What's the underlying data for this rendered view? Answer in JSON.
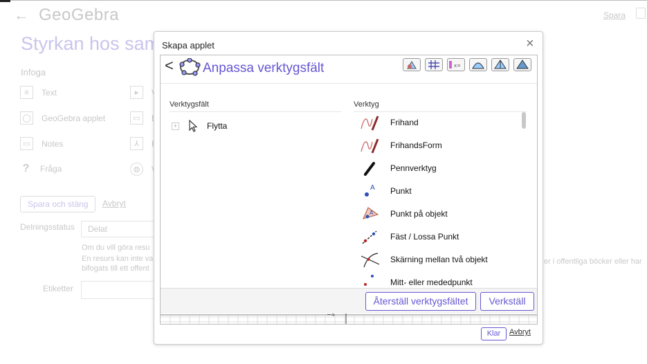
{
  "header": {
    "back_glyph": "←",
    "logo": "GeoGebra",
    "save_link": "Spara",
    "print_icon": "print-icon"
  },
  "background": {
    "title": "Styrkan hos samb",
    "insert_heading": "Infoga",
    "insert_left": [
      {
        "label": "Text",
        "icon": "text-icon"
      },
      {
        "label": "GeoGebra applet",
        "icon": "geogebra-icon"
      },
      {
        "label": "Notes",
        "icon": "notes-icon"
      },
      {
        "label": "Fråga",
        "icon": "question-icon"
      }
    ],
    "insert_right": [
      {
        "label": "V",
        "icon": "video-icon"
      },
      {
        "label": "E",
        "icon": "image-icon"
      },
      {
        "label": "F",
        "icon": "pdf-icon"
      },
      {
        "label": "V",
        "icon": "web-icon"
      }
    ],
    "save_close": "Spara och stäng",
    "cancel": "Avbryt",
    "sharing_label": "Delningsstatus",
    "sharing_value": "Delat",
    "notice_lines": [
      "Om du vill göra resu",
      "En resurs kan inte va",
      "bifogats till ett offent"
    ],
    "notice_right": "er i offentliga böcker eller har",
    "tags_label": "Etiketter"
  },
  "dialog": {
    "title": "Skapa applet",
    "close_glyph": "×",
    "toolbar_editor": {
      "back_glyph": "<",
      "title": "Anpassa verktygsfält",
      "toolbar_column": "Verktygsfält",
      "tools_column": "Verktyg",
      "toolbar_items": [
        {
          "label": "Flytta"
        }
      ],
      "tools": [
        {
          "label": "Frihand",
          "icon": "freehand-icon"
        },
        {
          "label": "FrihandsForm",
          "icon": "freehand-shape-icon"
        },
        {
          "label": "Pennverktyg",
          "icon": "pen-icon"
        },
        {
          "label": "Punkt",
          "icon": "point-icon"
        },
        {
          "label": "Punkt på objekt",
          "icon": "point-on-object-icon"
        },
        {
          "label": "Fäst / Lossa Punkt",
          "icon": "attach-detach-point-icon"
        },
        {
          "label": "Skärning mellan två objekt",
          "icon": "intersect-icon"
        },
        {
          "label": "Mitt- eller mededpunkt",
          "icon": "midpoint-icon"
        }
      ],
      "reset_button": "Återställ verktygsfältet",
      "apply_button": "Verkställ",
      "axis_tick_label": "−4"
    },
    "ok_button": "Klar",
    "cancel_link": "Avbryt"
  },
  "colors": {
    "accent": "#6557d2",
    "faded_accent": "#c9c4ec",
    "faded_text": "#c8c8c8"
  }
}
